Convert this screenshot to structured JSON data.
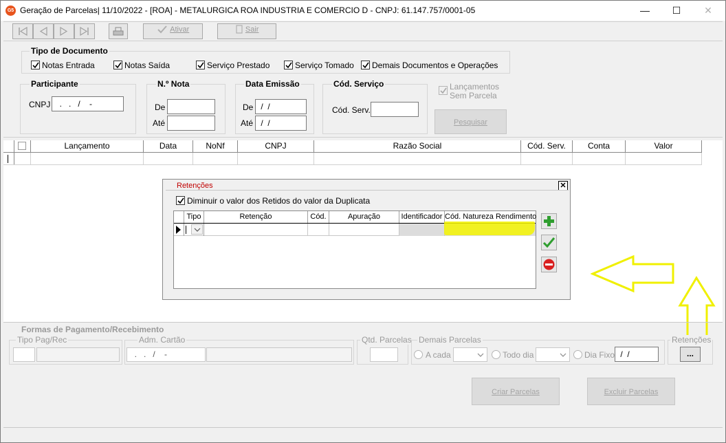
{
  "window": {
    "app_icon_text": "G5",
    "title": "Geração de Parcelas|  11/10/2022 - [ROA] - METALURGICA ROA INDUSTRIA E COMERCIO D - CNPJ: 61.147.757/0001-05",
    "minimize": "—",
    "maximize": "☐",
    "close": "✕"
  },
  "toolbar": {
    "ativar_label": "Ativar",
    "sair_label": "Sair"
  },
  "tipo_documento": {
    "title": "Tipo de Documento",
    "options": [
      {
        "label": "Notas Entrada",
        "checked": true
      },
      {
        "label": "Notas Saída",
        "checked": true
      },
      {
        "label": "Serviço Prestado",
        "checked": true
      },
      {
        "label": "Serviço Tomado",
        "checked": true
      },
      {
        "label": "Demais Documentos e Operações",
        "checked": true
      }
    ]
  },
  "participante": {
    "title": "Participante",
    "cnpj_label": "CNPJ",
    "cnpj_value": "  .   .   /    -"
  },
  "nota": {
    "title": "N.º Nota",
    "de_label": "De",
    "ate_label": "Até",
    "de_value": "",
    "ate_value": ""
  },
  "data_emissao": {
    "title": "Data Emissão",
    "de_label": "De",
    "ate_label": "Até",
    "de_value": " /  /",
    "ate_value": " /  /"
  },
  "cod_servico": {
    "title": "Cód. Serviço",
    "label": "Cód. Serv.",
    "value": ""
  },
  "lancamentos_sem_parcela": {
    "line1": "Lançamentos",
    "line2": "Sem Parcela",
    "checked": true
  },
  "pesquisar_label": "Pesquisar",
  "main_grid": {
    "columns": [
      "Lançamento",
      "Data",
      "NoNf",
      "CNPJ",
      "Razão Social",
      "Cód. Serv.",
      "Conta",
      "Valor"
    ]
  },
  "retencoes_dialog": {
    "title": "Retenções",
    "close": "✕",
    "diminuir_label": "Diminuir o valor dos Retidos do valor da Duplicata",
    "diminuir_checked": true,
    "columns": [
      "Tipo",
      "Retenção",
      "Cód.",
      "Apuração",
      "Identificador",
      "Cód. Natureza Rendimento"
    ],
    "highlight_color": "#f5f500"
  },
  "formas_pagamento": {
    "title": "Formas de Pagamento/Recebimento",
    "tipo_pag_rec": "Tipo Pag/Rec",
    "adm_cartao": "Adm. Cartão",
    "adm_cartao_value": "  .   .   /    -",
    "qtd_parcelas": "Qtd. Parcelas",
    "demais_parcelas": "Demais Parcelas",
    "a_cada": "A cada",
    "todo_dia": "Todo dia",
    "dia_fixo": "Dia Fixo",
    "dia_fixo_value": " /  /",
    "retencoes": "Retenções",
    "retencoes_button": "...",
    "criar_parcelas": "Criar Parcelas",
    "excluir_parcelas": "Excluir Parcelas"
  }
}
